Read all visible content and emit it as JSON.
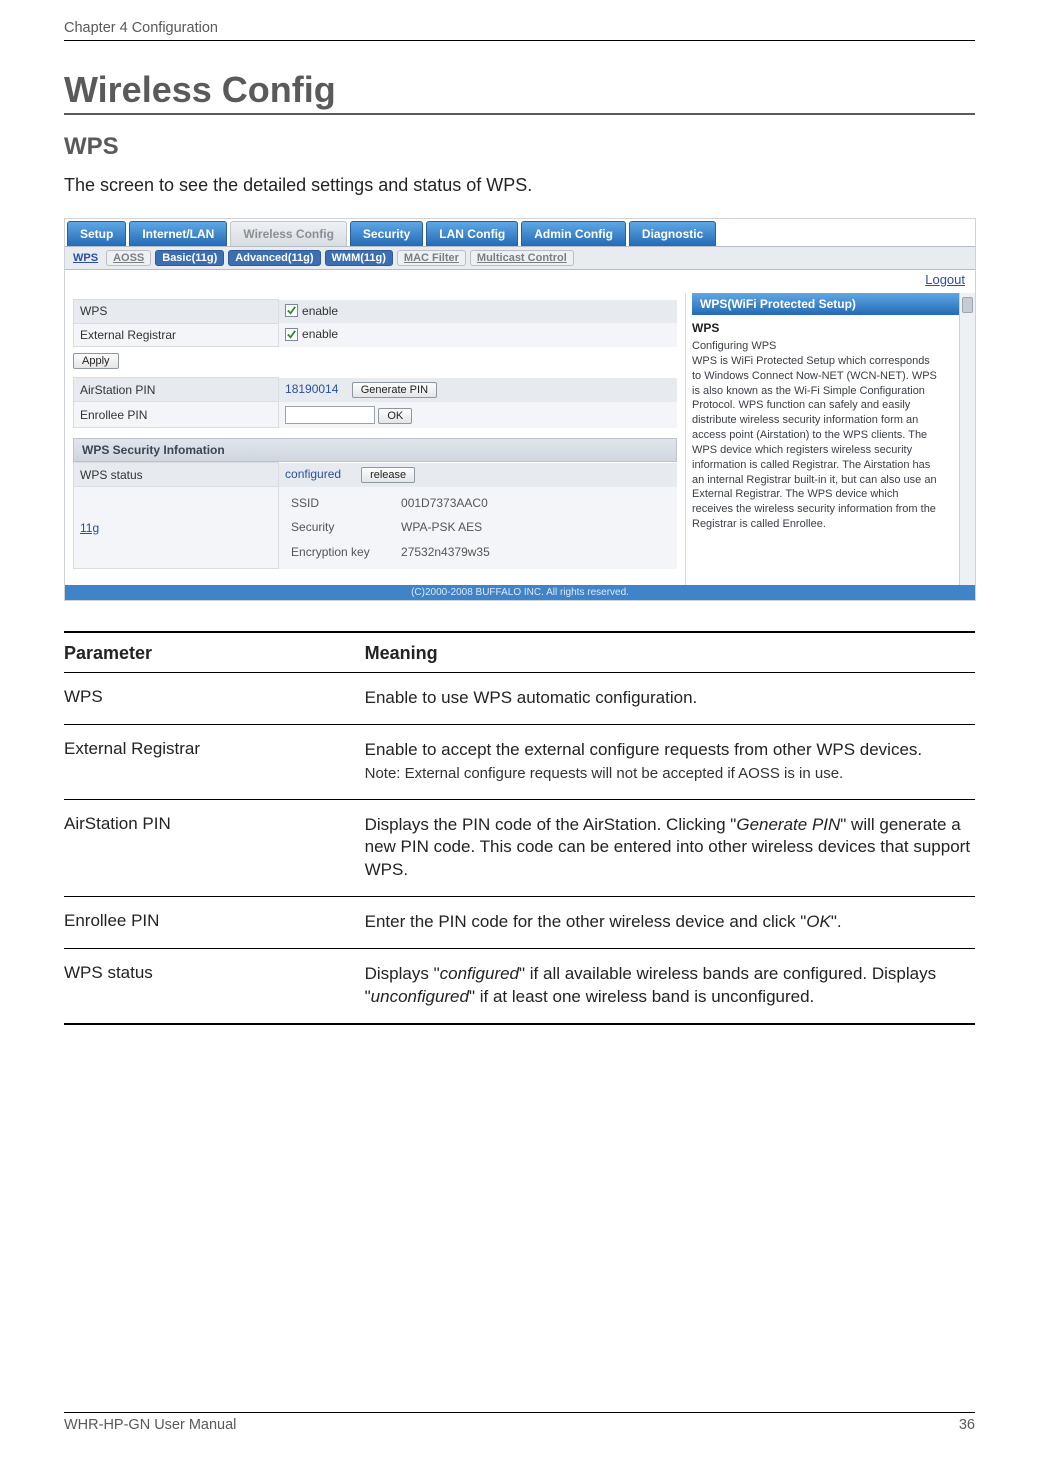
{
  "header": {
    "chapter": "Chapter 4  Configuration"
  },
  "h1": "Wireless Config",
  "h2": "WPS",
  "intro": "The screen to see the detailed settings and status of WPS.",
  "ui": {
    "tabs_primary": [
      "Setup",
      "Internet/LAN",
      "Wireless Config",
      "Security",
      "LAN Config",
      "Admin Config",
      "Diagnostic"
    ],
    "tabs_primary_active_index": 2,
    "tabs_secondary": [
      {
        "label": "WPS",
        "type": "link-plain"
      },
      {
        "label": "AOSS",
        "type": "inactive"
      },
      {
        "label": "Basic(11g)",
        "type": "active-blue"
      },
      {
        "label": "Advanced(11g)",
        "type": "active-blue"
      },
      {
        "label": "WMM(11g)",
        "type": "active-blue"
      },
      {
        "label": "MAC Filter",
        "type": "inactive"
      },
      {
        "label": "Multicast Control",
        "type": "inactive"
      }
    ],
    "logout": "Logout",
    "rows": {
      "wps_label": "WPS",
      "wps_enable": "enable",
      "ext_label": "External Registrar",
      "ext_enable": "enable",
      "apply": "Apply",
      "airpin_label": "AirStation PIN",
      "airpin_value": "18190014",
      "generate_pin": "Generate PIN",
      "enrollee_label": "Enrollee PIN",
      "enrollee_value": "",
      "ok": "OK",
      "sec_header": "WPS Security Infomation",
      "status_label": "WPS status",
      "status_value": "configured",
      "release": "release",
      "band": "11g",
      "ssid_label": "SSID",
      "ssid_value": "001D7373AAC0",
      "security_label": "Security",
      "security_value": "WPA-PSK AES",
      "enckey_label": "Encryption key",
      "enckey_value": "27532n4379w35"
    },
    "help": {
      "title": "WPS(WiFi Protected Setup)",
      "sub": "WPS",
      "sub2": "Configuring WPS",
      "text": "WPS is WiFi Protected Setup which corresponds to Windows Connect Now-NET (WCN-NET). WPS is also known as the Wi-Fi Simple Configuration Protocol. WPS function can safely and easily distribute wireless security information form an access point (Airstation) to the WPS clients. The WPS device which registers wireless security information is called Registrar. The Airstation has an internal Registrar built-in it, but can also use an External Registrar. The WPS device which receives the wireless security information from the Registrar is called Enrollee."
    },
    "copyright": "(C)2000-2008 BUFFALO INC. All rights reserved."
  },
  "pm": {
    "head_param": "Parameter",
    "head_mean": "Meaning",
    "rows": [
      {
        "p": "WPS",
        "m": "Enable to use WPS automatic configuration."
      },
      {
        "p": "External Registrar",
        "m": "Enable to accept the external configure requests from other WPS devices.",
        "note": "Note:  External configure requests will not be accepted if AOSS is in use."
      },
      {
        "p": "AirStation PIN",
        "m": "Displays the PIN code of the AirStation. Clicking \"<i>Generate PIN</i>\" will generate a new PIN code. This code can be entered into other wireless devices that support WPS."
      },
      {
        "p": "Enrollee PIN",
        "m": "Enter the PIN code for the other wireless device and click \"<i>OK</i>\"."
      },
      {
        "p": "WPS status",
        "m": "Displays \"<i>configured</i>\" if all available wireless bands are configured. Displays \"<i>unconfigured</i>\" if at least one wireless band is unconfigured."
      }
    ]
  },
  "footer": {
    "manual": "WHR-HP-GN User Manual",
    "page": "36"
  }
}
